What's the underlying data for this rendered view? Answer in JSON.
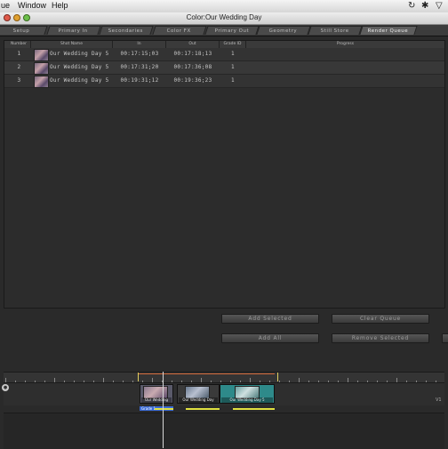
{
  "menubar": {
    "items": [
      "ue",
      "Window",
      "Help"
    ],
    "icons": [
      "time-machine-icon",
      "bluetooth-icon",
      "wifi-icon"
    ]
  },
  "window": {
    "title": "Color:Our Wedding Day"
  },
  "tabs": [
    {
      "label": "Setup",
      "active": false
    },
    {
      "label": "Primary In",
      "active": false
    },
    {
      "label": "Secondaries",
      "active": false
    },
    {
      "label": "Color FX",
      "active": false
    },
    {
      "label": "Primary Out",
      "active": false
    },
    {
      "label": "Geometry",
      "active": false
    },
    {
      "label": "Still Store",
      "active": false
    },
    {
      "label": "Render Queue",
      "active": true
    }
  ],
  "queue": {
    "columns": [
      "Number",
      "Shot Name",
      "In",
      "Out",
      "Grade ID",
      "Progress"
    ],
    "rows": [
      {
        "number": "1",
        "shot_name": "Our Wedding Day 5",
        "in": "00:17:15;03",
        "out": "00:17:18;13",
        "grade_id": "1"
      },
      {
        "number": "2",
        "shot_name": "Our Wedding Day 5",
        "in": "00:17:31;20",
        "out": "00:17:36;08",
        "grade_id": "1"
      },
      {
        "number": "3",
        "shot_name": "Our Wedding Day 5",
        "in": "00:19:31;12",
        "out": "00:19:36;23",
        "grade_id": "1"
      }
    ]
  },
  "buttons": {
    "add_selected": "Add Selected",
    "clear_queue": "Clear Queue",
    "add_all": "Add All",
    "remove_selected": "Remove Selected"
  },
  "timeline": {
    "clips": [
      {
        "label": "Our Wedding",
        "color": "#5a5a6a"
      },
      {
        "label": "Our Wedding Day",
        "color": "#3a3a3a"
      },
      {
        "label": "Our Wedding Day 5",
        "color": "#2e8a8a"
      }
    ],
    "grade_label": "Grade 1",
    "colors": {
      "accent": "#2e8a8a",
      "grade": "#3a6ad6",
      "render": "#e0e040",
      "playhead": "#e0d060"
    }
  }
}
